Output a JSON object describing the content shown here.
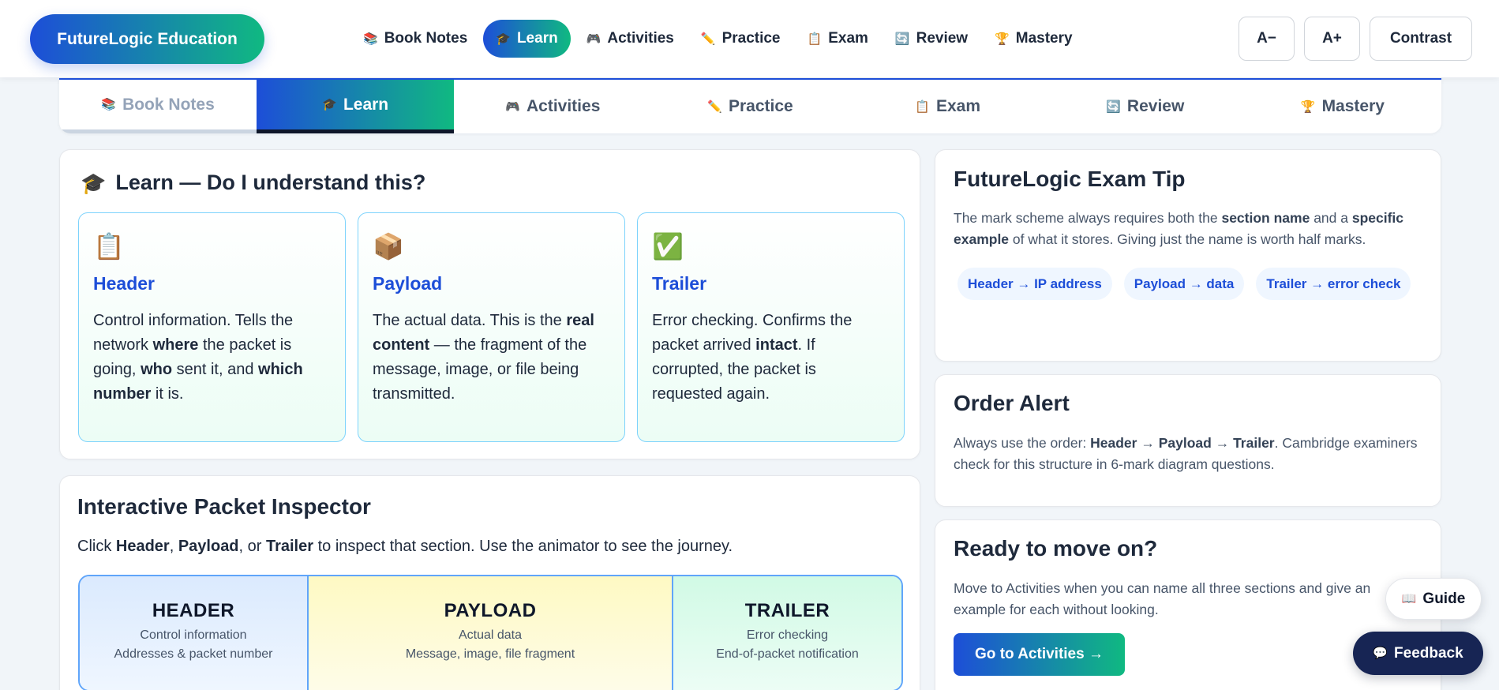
{
  "brand": {
    "name": "FutureLogic Education"
  },
  "topnav": {
    "items": [
      {
        "icon": "books-icon",
        "glyph": "📚",
        "label": "Book Notes",
        "active": false
      },
      {
        "icon": "graduation-cap-icon",
        "glyph": "🎓",
        "label": "Learn",
        "active": true
      },
      {
        "icon": "game-controller-icon",
        "glyph": "🎮",
        "label": "Activities",
        "active": false
      },
      {
        "icon": "pencil-icon",
        "glyph": "✏️",
        "label": "Practice",
        "active": false
      },
      {
        "icon": "clipboard-icon",
        "glyph": "📋",
        "label": "Exam",
        "active": false
      },
      {
        "icon": "refresh-icon",
        "glyph": "🔄",
        "label": "Review",
        "active": false
      },
      {
        "icon": "trophy-icon",
        "glyph": "🏆",
        "label": "Mastery",
        "active": false
      }
    ]
  },
  "accessibility": {
    "decrease_label": "A−",
    "increase_label": "A+",
    "contrast_label": "Contrast"
  },
  "learn": {
    "title_icon": "🎓",
    "title": "Learn — Do I understand this?",
    "concepts": [
      {
        "icon": "clipboard-icon",
        "glyph": "📋",
        "name": "Header",
        "desc_html": "Control information. Tells the network <b>where</b> the packet is going, <b>who</b> sent it, and <b>which number</b> it is."
      },
      {
        "icon": "package-icon",
        "glyph": "📦",
        "name": "Payload",
        "desc_html": "The actual data. This is the <b>real content</b> — the fragment of the message, image, or file being transmitted."
      },
      {
        "icon": "check-mark-icon",
        "glyph": "✅",
        "name": "Trailer",
        "desc_html": "Error checking. Confirms the packet arrived <b>intact</b>. If corrupted, the packet is requested again."
      }
    ]
  },
  "inspector": {
    "title": "Interactive Packet Inspector",
    "instructions_html": "Click <b>Header</b>, <b>Payload</b>, or <b>Trailer</b> to inspect that section. Use the animator to see the journey.",
    "segments": [
      {
        "name": "HEADER",
        "line1": "Control information",
        "line2": "Addresses & packet number"
      },
      {
        "name": "PAYLOAD",
        "line1": "Actual data",
        "line2": "Message, image, file fragment"
      },
      {
        "name": "TRAILER",
        "line1": "Error checking",
        "line2": "End-of-packet notification"
      }
    ]
  },
  "tip": {
    "title": "FutureLogic Exam Tip",
    "text_html": "The mark scheme always requires both the <b>section name</b> and a <b>specific example</b> of what it stores. Giving just the name is worth half marks.",
    "pills": [
      "Header → IP address",
      "Payload → data",
      "Trailer → error check"
    ]
  },
  "order": {
    "title": "Order Alert",
    "text_html": "Always use the order: <b>Header</b> → <b>Payload</b> → <b>Trailer</b>. Cambridge examiners check for this structure in 6-mark diagram questions."
  },
  "ready": {
    "title": "Ready to move on?",
    "text": "Move to Activities when you can name all three sections and give an example for each without looking.",
    "button_label": "Go to Activities →"
  },
  "floating": {
    "guide_glyph": "📖",
    "guide_label": "Guide",
    "feedback_glyph": "💬",
    "feedback_label": "Feedback"
  },
  "colors": {
    "accent_blue": "#1d4ed8",
    "accent_green": "#10b981",
    "dark_navy": "#172554",
    "header_segment": "#dbeafe",
    "payload_segment": "#fef9c3",
    "trailer_segment": "#d1fae5"
  }
}
